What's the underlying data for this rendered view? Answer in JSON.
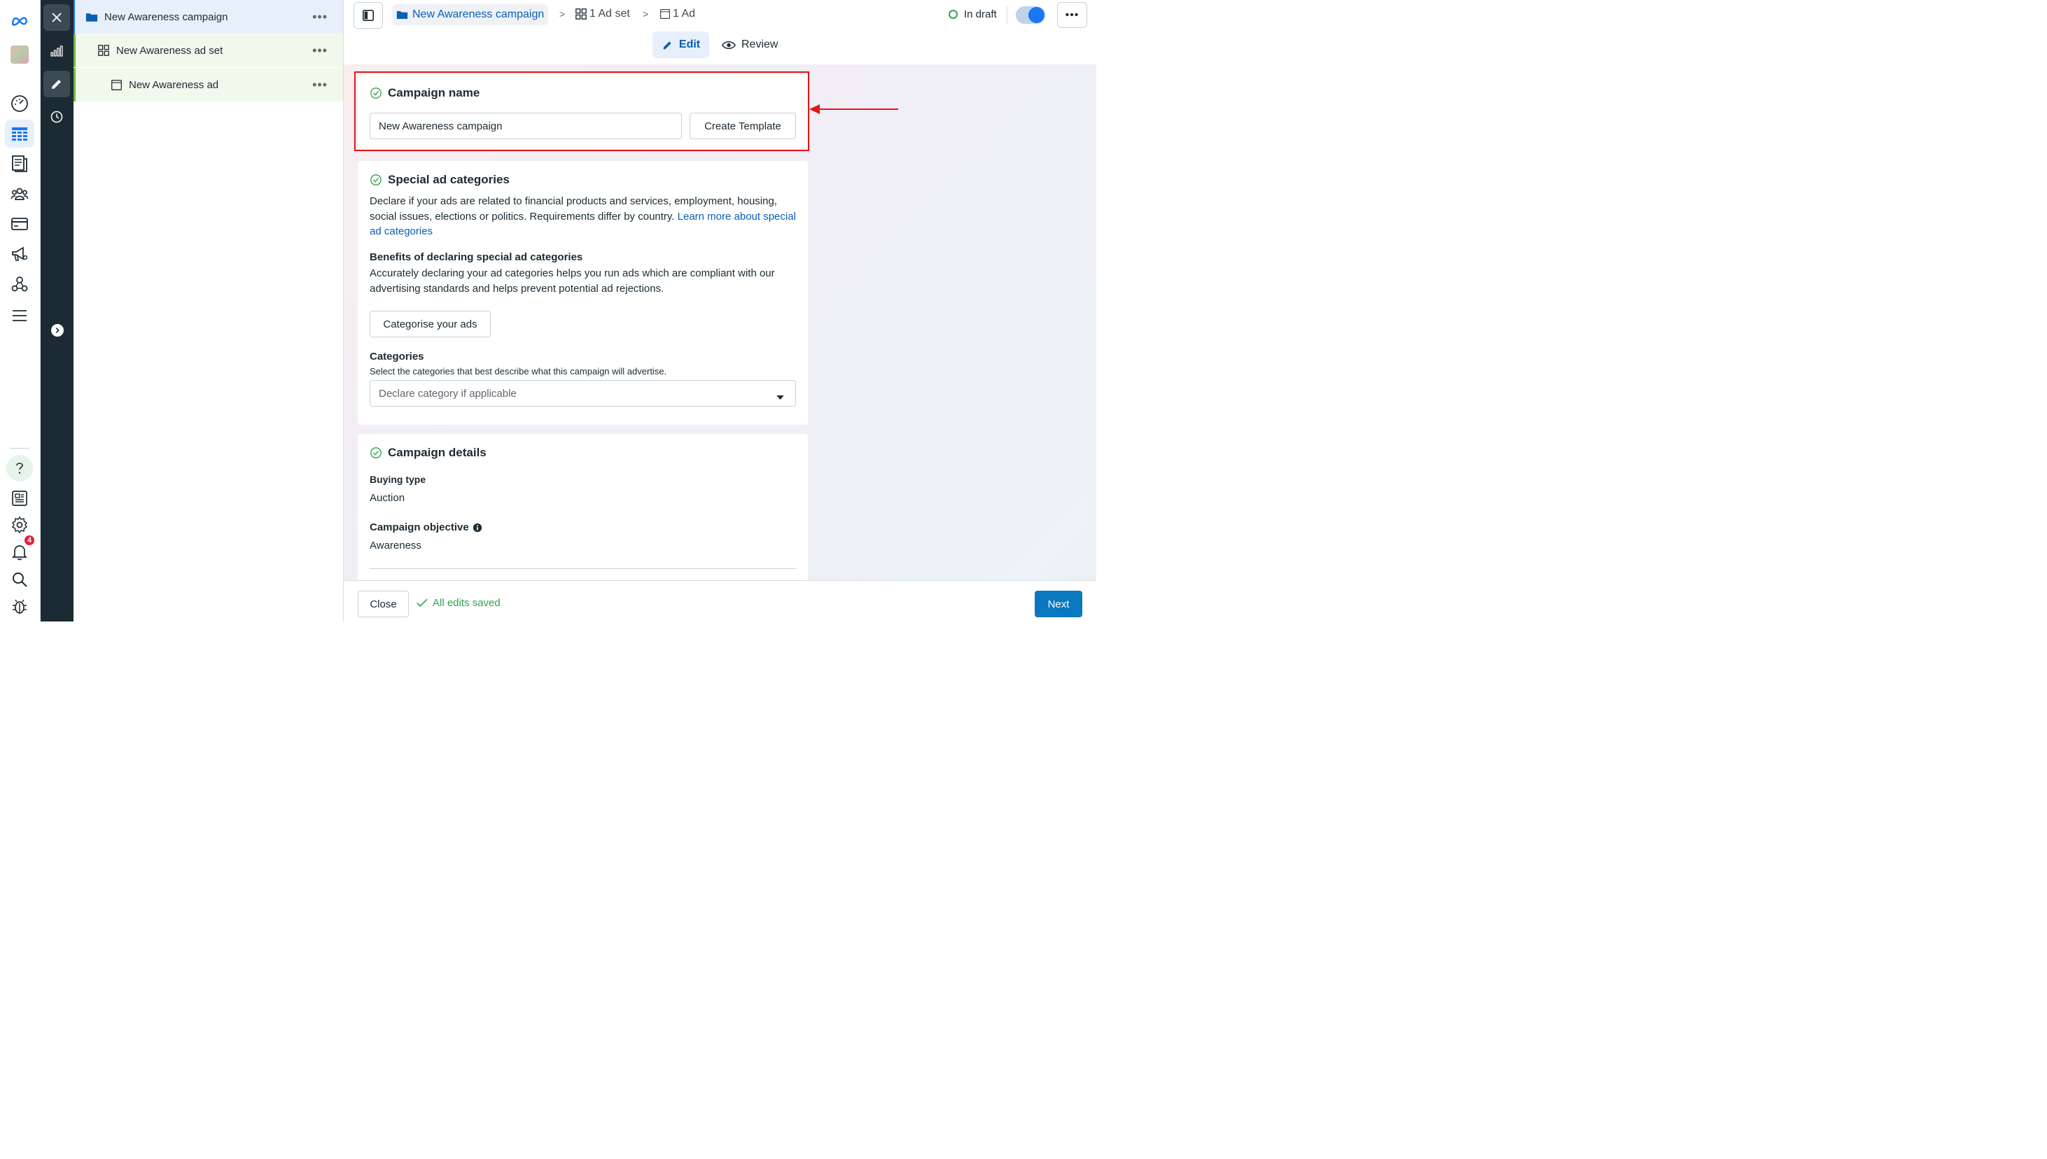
{
  "nav_rail": {
    "notification_count": "4"
  },
  "tree": {
    "campaign": "New Awareness campaign",
    "adset": "New Awareness ad set",
    "ad": "New Awareness ad",
    "more": "•••"
  },
  "header": {
    "breadcrumb_campaign": "New Awareness campaign",
    "breadcrumb_adset": "1 Ad set",
    "breadcrumb_ad": "1 Ad",
    "separator": ">",
    "status": "In draft",
    "more": "•••",
    "tabs": [
      {
        "label": "Edit"
      },
      {
        "label": "Review"
      }
    ]
  },
  "campaign_name": {
    "title": "Campaign name",
    "value": "New Awareness campaign",
    "create_template": "Create Template"
  },
  "special_ad": {
    "title": "Special ad categories",
    "description": "Declare if your ads are related to financial products and services, employment, housing, social issues, elections or politics. Requirements differ by country. ",
    "learn_more": "Learn more about special ad categories",
    "benefits_title": "Benefits of declaring special ad categories",
    "benefits_text": "Accurately declaring your ad categories helps you run ads which are compliant with our advertising standards and helps prevent potential ad rejections.",
    "categorise_button": "Categorise your ads",
    "categories_label": "Categories",
    "categories_help": "Select the categories that best describe what this campaign will advertise.",
    "categories_placeholder": "Declare category if applicable"
  },
  "campaign_details": {
    "title": "Campaign details",
    "buying_type_label": "Buying type",
    "buying_type_value": "Auction",
    "objective_label": "Campaign objective",
    "objective_value": "Awareness"
  },
  "footer": {
    "close": "Close",
    "saved": "All edits saved",
    "next": "Next"
  },
  "colors": {
    "accent": "#1877f2",
    "link": "#0a5fb4",
    "success": "#31a24c",
    "highlight": "#e4141b",
    "primary_button": "#0a78be"
  }
}
